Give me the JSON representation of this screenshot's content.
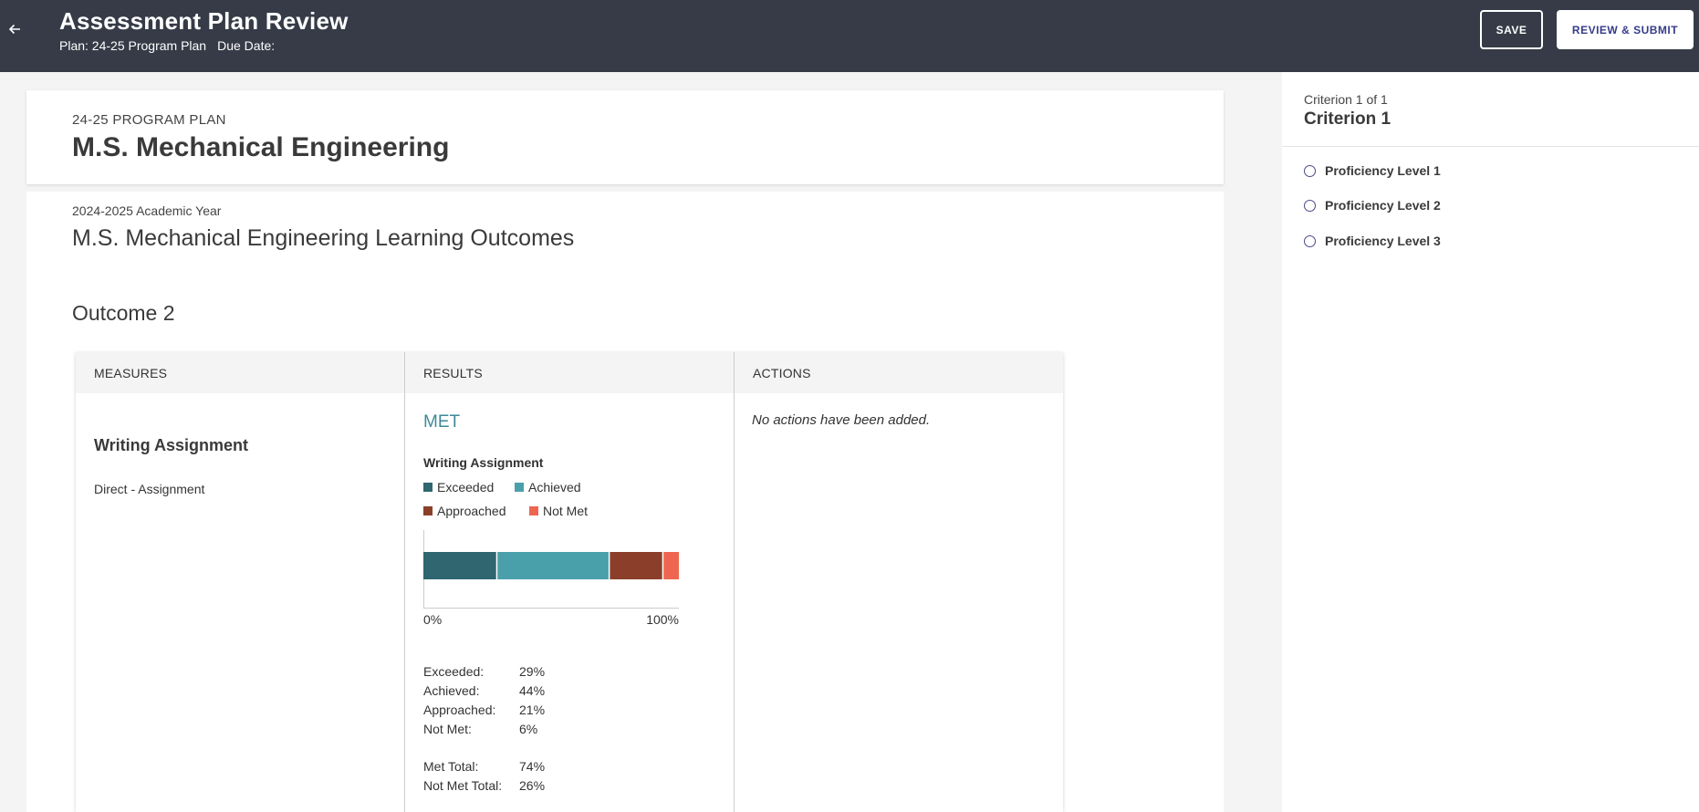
{
  "header": {
    "title": "Assessment Plan Review",
    "plan": "Plan: 24-25 Program Plan",
    "due_date": "Due Date:",
    "save_label": "SAVE",
    "submit_label": "REVIEW & SUBMIT",
    "back_icon": "arrow-left-icon"
  },
  "plan_card": {
    "label": "24-25 PROGRAM PLAN",
    "name": "M.S. Mechanical Engineering"
  },
  "main": {
    "year": "2024-2025 Academic Year",
    "outcomes_title": "M.S. Mechanical Engineering Learning Outcomes",
    "outcome": "Outcome 2"
  },
  "table": {
    "headers": [
      "MEASURES",
      "RESULTS",
      "ACTIONS"
    ],
    "measure_name": "Writing Assignment",
    "measure_type": "Direct - Assignment",
    "status": "MET",
    "no_actions": "No actions have been added."
  },
  "chart_data": {
    "type": "bar",
    "orientation": "horizontal-stacked",
    "title": "Writing Assignment",
    "series": [
      {
        "name": "Exceeded",
        "value": 29,
        "color": "#2f6670"
      },
      {
        "name": "Achieved",
        "value": 44,
        "color": "#4aa0aa"
      },
      {
        "name": "Approached",
        "value": 21,
        "color": "#8b3f2a"
      },
      {
        "name": "Not Met",
        "value": 6,
        "color": "#ef6650"
      }
    ],
    "xlim": [
      0,
      100
    ],
    "x_ticks": [
      "0%",
      "100%"
    ]
  },
  "stats": {
    "rows": [
      {
        "label": "Exceeded:",
        "value": "29%"
      },
      {
        "label": "Achieved:",
        "value": "44%"
      },
      {
        "label": "Approached:",
        "value": "21%"
      },
      {
        "label": "Not Met:",
        "value": "6%"
      }
    ],
    "totals": [
      {
        "label": "Met Total:",
        "value": "74%"
      },
      {
        "label": "Not Met Total:",
        "value": "26%"
      }
    ]
  },
  "panel": {
    "count": "Criterion 1 of 1",
    "title": "Criterion 1",
    "levels": [
      "Proficiency Level 1",
      "Proficiency Level 2",
      "Proficiency Level 3"
    ]
  }
}
